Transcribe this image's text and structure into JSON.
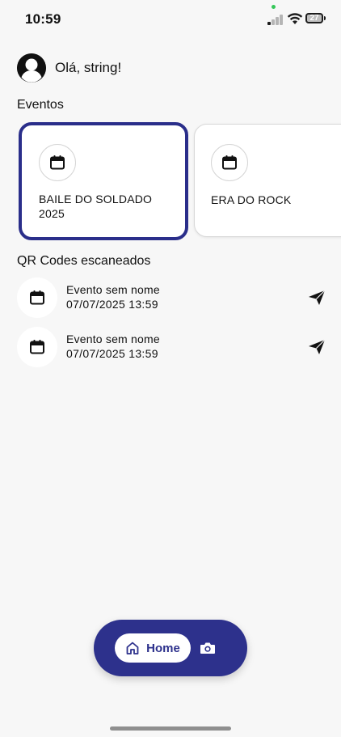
{
  "status_bar": {
    "time": "10:59",
    "battery_level": "27"
  },
  "header": {
    "greeting": "Olá, string!"
  },
  "events": {
    "section_title": "Eventos",
    "items": [
      {
        "title": "BAILE DO SOLDADO 2025",
        "selected": true,
        "icon": "calendar-icon"
      },
      {
        "title": "ERA DO ROCK",
        "selected": false,
        "icon": "calendar-icon"
      }
    ]
  },
  "scanned": {
    "section_title": "QR Codes escaneados",
    "items": [
      {
        "title": "Evento sem nome",
        "date": "07/07/2025 13:59",
        "icon": "calendar-icon",
        "action_icon": "send-icon"
      },
      {
        "title": "Evento sem nome",
        "date": "07/07/2025 13:59",
        "icon": "calendar-icon",
        "action_icon": "send-icon"
      }
    ]
  },
  "bottom_nav": {
    "home_label": "Home",
    "home_icon": "home-icon",
    "camera_icon": "camera-icon"
  },
  "colors": {
    "accent": "#2d318c",
    "background": "#f7f7f7",
    "status_dot": "#35c759"
  }
}
